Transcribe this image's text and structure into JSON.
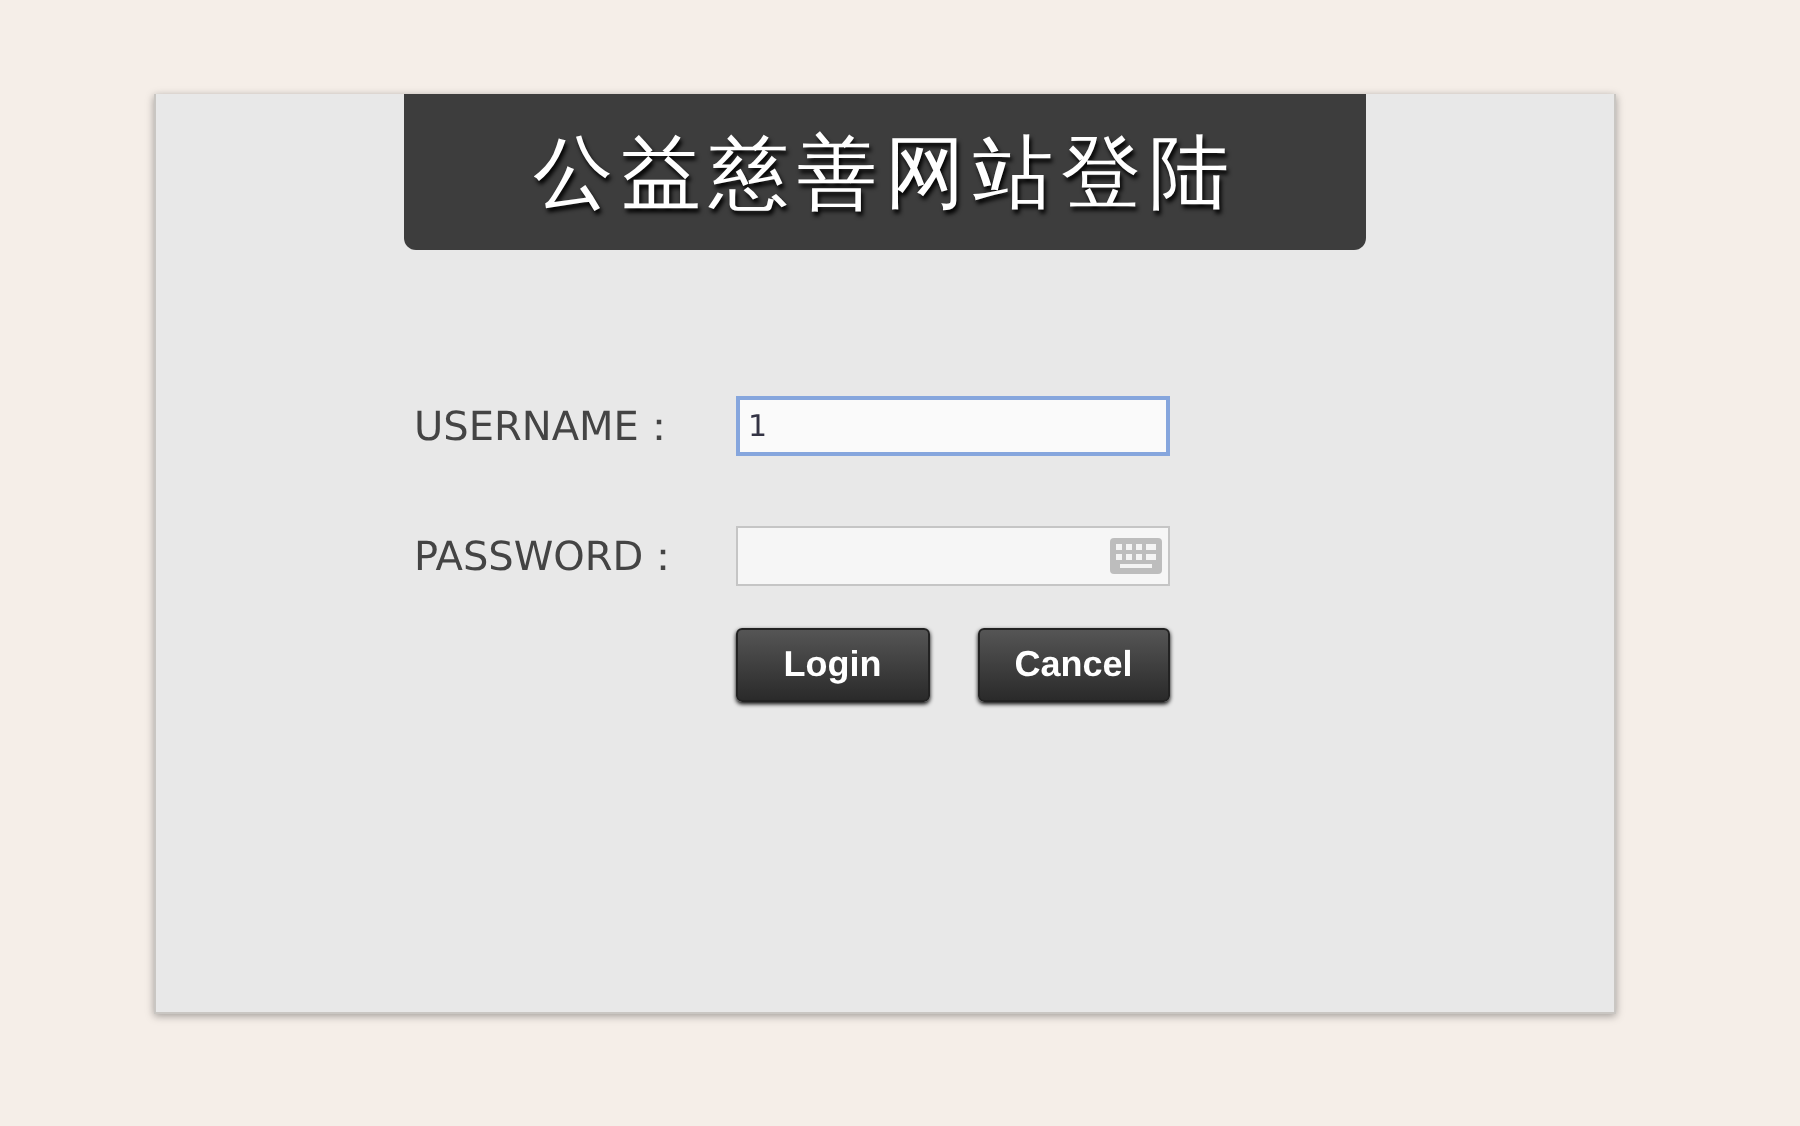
{
  "title": "公益慈善网站登陆",
  "fields": [
    {
      "label": "USERNAME：",
      "value": "1",
      "kind": "text"
    },
    {
      "label": "PASSWORD：",
      "kind": "password"
    }
  ],
  "buttons": [
    "Login",
    "Cancel"
  ]
}
